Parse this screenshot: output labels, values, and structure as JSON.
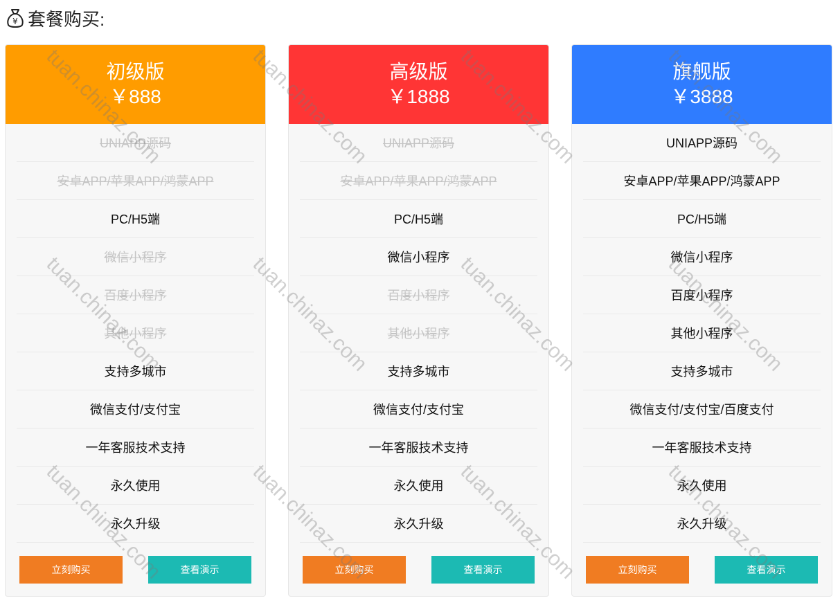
{
  "page": {
    "title": "套餐购买:",
    "icon": "money-bag-icon"
  },
  "colors": {
    "basic": "#ff9c00",
    "advanced": "#ff3535",
    "flagship": "#2f7cff",
    "buy_button": "#f07c22",
    "demo_button": "#1cbab3"
  },
  "plans": [
    {
      "name": "初级版",
      "price": "￥888",
      "features": [
        {
          "label": "UNIAPP源码",
          "included": false
        },
        {
          "label": "安卓APP/苹果APP/鸿蒙APP",
          "included": false
        },
        {
          "label": "PC/H5端",
          "included": true
        },
        {
          "label": "微信小程序",
          "included": false
        },
        {
          "label": "百度小程序",
          "included": false
        },
        {
          "label": "其他小程序",
          "included": false
        },
        {
          "label": "支持多城市",
          "included": true
        },
        {
          "label": "微信支付/支付宝",
          "included": true
        },
        {
          "label": "一年客服技术支持",
          "included": true
        },
        {
          "label": "永久使用",
          "included": true
        },
        {
          "label": "永久升级",
          "included": true
        }
      ],
      "buy_label": "立刻购买",
      "demo_label": "查看演示"
    },
    {
      "name": "高级版",
      "price": "￥1888",
      "features": [
        {
          "label": "UNIAPP源码",
          "included": false
        },
        {
          "label": "安卓APP/苹果APP/鸿蒙APP",
          "included": false
        },
        {
          "label": "PC/H5端",
          "included": true
        },
        {
          "label": "微信小程序",
          "included": true
        },
        {
          "label": "百度小程序",
          "included": false
        },
        {
          "label": "其他小程序",
          "included": false
        },
        {
          "label": "支持多城市",
          "included": true
        },
        {
          "label": "微信支付/支付宝",
          "included": true
        },
        {
          "label": "一年客服技术支持",
          "included": true
        },
        {
          "label": "永久使用",
          "included": true
        },
        {
          "label": "永久升级",
          "included": true
        }
      ],
      "buy_label": "立刻购买",
      "demo_label": "查看演示"
    },
    {
      "name": "旗舰版",
      "price": "￥3888",
      "features": [
        {
          "label": "UNIAPP源码",
          "included": true
        },
        {
          "label": "安卓APP/苹果APP/鸿蒙APP",
          "included": true
        },
        {
          "label": "PC/H5端",
          "included": true
        },
        {
          "label": "微信小程序",
          "included": true
        },
        {
          "label": "百度小程序",
          "included": true
        },
        {
          "label": "其他小程序",
          "included": true
        },
        {
          "label": "支持多城市",
          "included": true
        },
        {
          "label": "微信支付/支付宝/百度支付",
          "included": true
        },
        {
          "label": "一年客服技术支持",
          "included": true
        },
        {
          "label": "永久使用",
          "included": true
        },
        {
          "label": "永久升级",
          "included": true
        }
      ],
      "buy_label": "立刻购买",
      "demo_label": "查看演示"
    }
  ],
  "watermark": "tuan.chinaz.com"
}
